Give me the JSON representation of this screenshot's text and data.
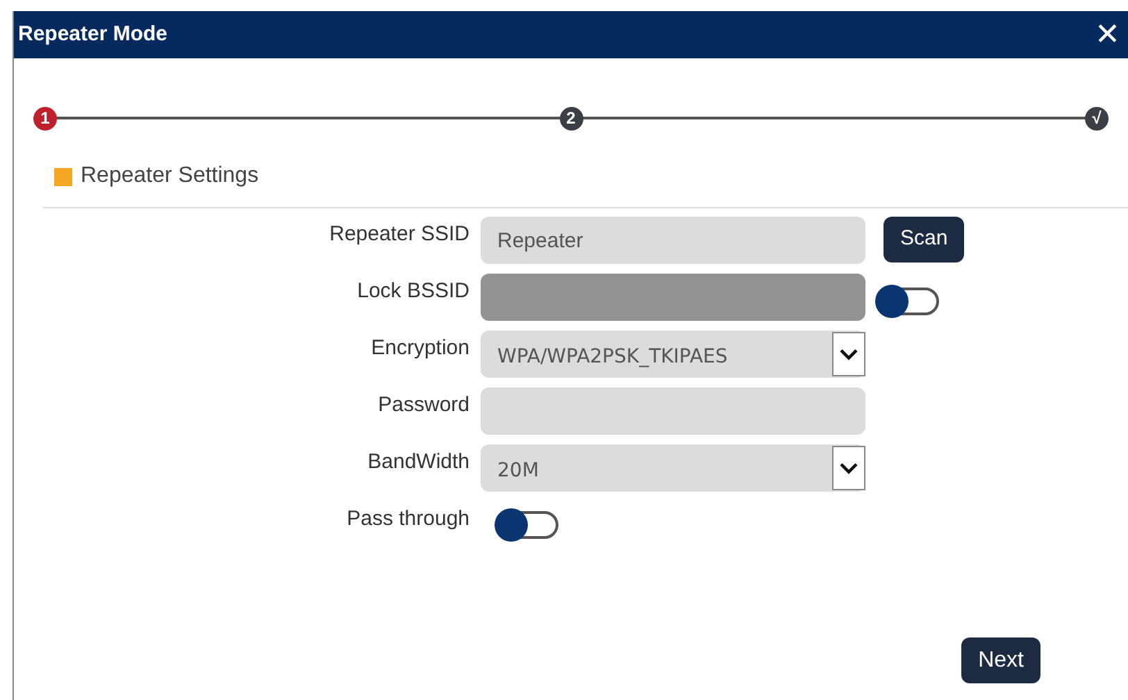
{
  "window": {
    "title": "Repeater Mode",
    "close": "✕"
  },
  "steps": [
    {
      "label": "1",
      "selected": true
    },
    {
      "label": "2",
      "selected": false
    },
    {
      "label": "√",
      "selected": false
    }
  ],
  "section": {
    "title": "Repeater Settings"
  },
  "fields": [
    {
      "kind": "text",
      "label": "Repeater SSID",
      "value": "Repeater",
      "button": "Scan"
    },
    {
      "kind": "text",
      "label": "Lock BSSID",
      "disabled": true,
      "toggle_on": false
    },
    {
      "kind": "select",
      "label": "Encryption",
      "value": "WPA/WPA2PSK_TKIPAES"
    },
    {
      "kind": "text",
      "label": "Password"
    },
    {
      "kind": "select",
      "label": "BandWidth",
      "value": "20M"
    },
    {
      "kind": "toggle",
      "label": "Pass through",
      "on": false
    }
  ],
  "buttons": [
    {
      "label": "Next"
    }
  ]
}
